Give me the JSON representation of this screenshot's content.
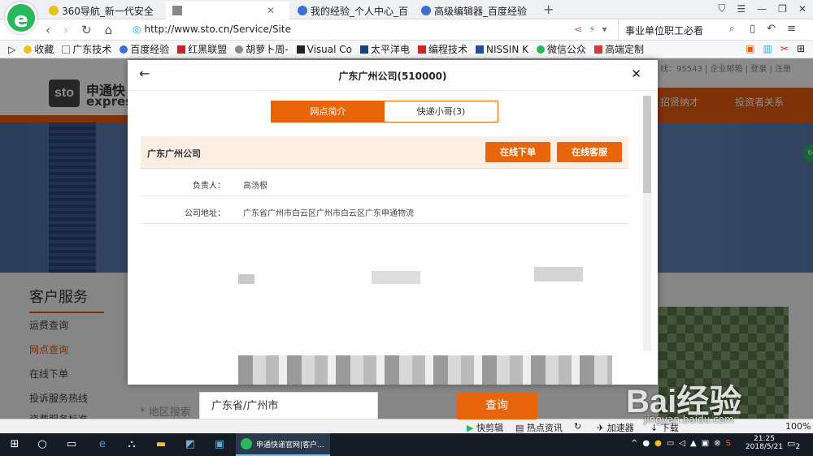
{
  "browser": {
    "tabs": [
      {
        "label": "360导航_新一代安全",
        "icon_color": "#2bb85c"
      },
      {
        "label": "",
        "icon_color": "#888888"
      },
      {
        "label": "我的经验_个人中心_百",
        "icon_color": "#3a6fd8"
      },
      {
        "label": "高级编辑器_百度经验",
        "icon_color": "#3a6fd8"
      }
    ],
    "new_tab_label": "+",
    "url": "http://www.sto.cn/Service/Site",
    "search_text": "事业单位职工必看",
    "bookmarks": [
      "收藏",
      "广东技术",
      "百度经验",
      "红黑联盟",
      "胡萝卜周-",
      "Visual Co",
      "太平洋电",
      "编程技术",
      "NISSIN K",
      "微信公众",
      "高端定制"
    ]
  },
  "site": {
    "logo_text": "sto",
    "brand_text": "申通快",
    "brand_sub": "expres",
    "top_links": "线：95543 | 企业邮箱 | 登录 | 注册",
    "nav": [
      "招贤纳才",
      "投资者关系"
    ],
    "sidebar_title": "客户服务",
    "sidebar_items": [
      "运费查询",
      "网点查询",
      "在线下单",
      "投诉服务热线",
      "资费服务标准"
    ],
    "search_label": "* 地区搜索",
    "search_value": "广东省/广州市",
    "search_button": "查询"
  },
  "modal": {
    "title": "广东广州公司(510000)",
    "tabs": [
      "网点简介",
      "快递小哥(3)"
    ],
    "org_name": "广东广州公司",
    "order_button": "在线下单",
    "service_button": "在线客服",
    "rows": [
      {
        "label": "负责人：",
        "value": "高汤根"
      },
      {
        "label": "公司地址：",
        "value": "广东省广州市白云区广州市白云区广东申通物流"
      }
    ]
  },
  "statusbar": {
    "items": [
      "快剪辑",
      "热点资讯",
      "加速器",
      "下载",
      "100%"
    ]
  },
  "taskbar": {
    "app_label": "申通快递官网|客户...",
    "time": "21:25",
    "date": "2018/5/21",
    "notification_count": "2"
  },
  "watermark": {
    "text": "Bai经验",
    "sub": "jingyan.baidu.com"
  },
  "colors": {
    "accent": "#e8650c",
    "tab_active_bg": "#ffffff",
    "taskbar": "#141b24"
  }
}
